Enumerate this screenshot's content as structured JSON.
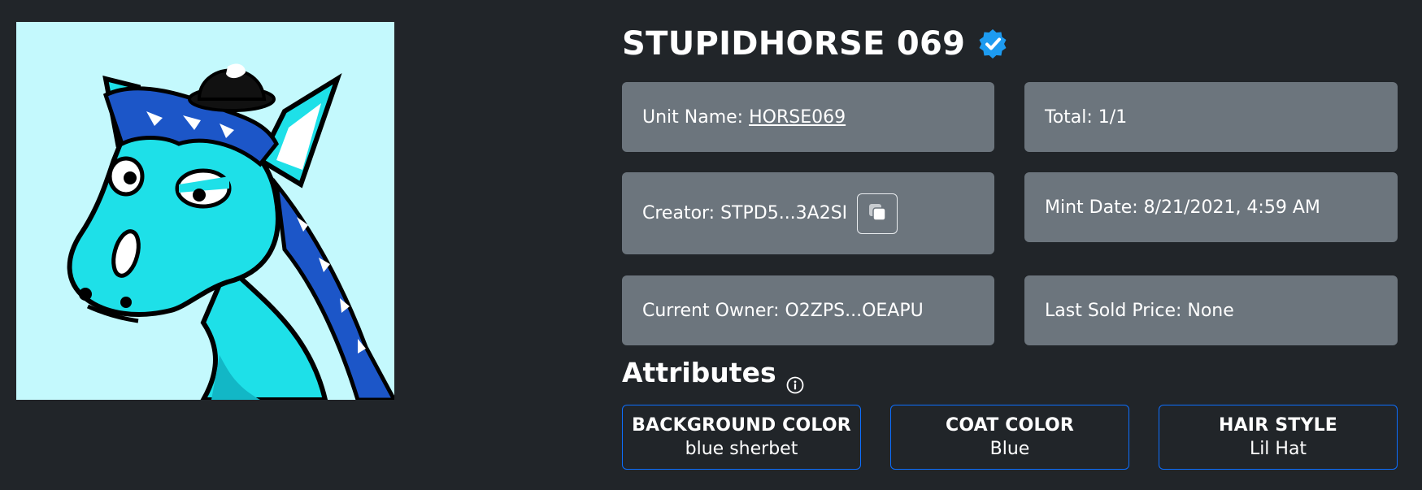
{
  "nft": {
    "title": "STUPIDHORSE 069",
    "image_icon": "horse-artwork",
    "verified_icon": "verified-badge-icon",
    "colors": {
      "background": "#212529",
      "card": "#6c757d",
      "accent_blue": "#0d6efd",
      "verified": "#1d9bf0",
      "image_bg": "#c4f9fd"
    }
  },
  "details": {
    "unit_name_label": "Unit Name: ",
    "unit_name_value": "HORSE069",
    "total": "Total: 1/1",
    "creator": "Creator: STPD5...3A2SI",
    "copy_icon": "copy-icon",
    "mint_date": "Mint Date: 8/21/2021, 4:59 AM",
    "current_owner": "Current Owner: O2ZPS...OEAPU",
    "last_sold": "Last Sold Price: None"
  },
  "attributes": {
    "heading": "Attributes",
    "info_icon": "info-circle-icon",
    "items": [
      {
        "name": "BACKGROUND COLOR",
        "value": "blue sherbet"
      },
      {
        "name": "COAT COLOR",
        "value": "Blue"
      },
      {
        "name": "HAIR STYLE",
        "value": "Lil Hat"
      }
    ]
  }
}
